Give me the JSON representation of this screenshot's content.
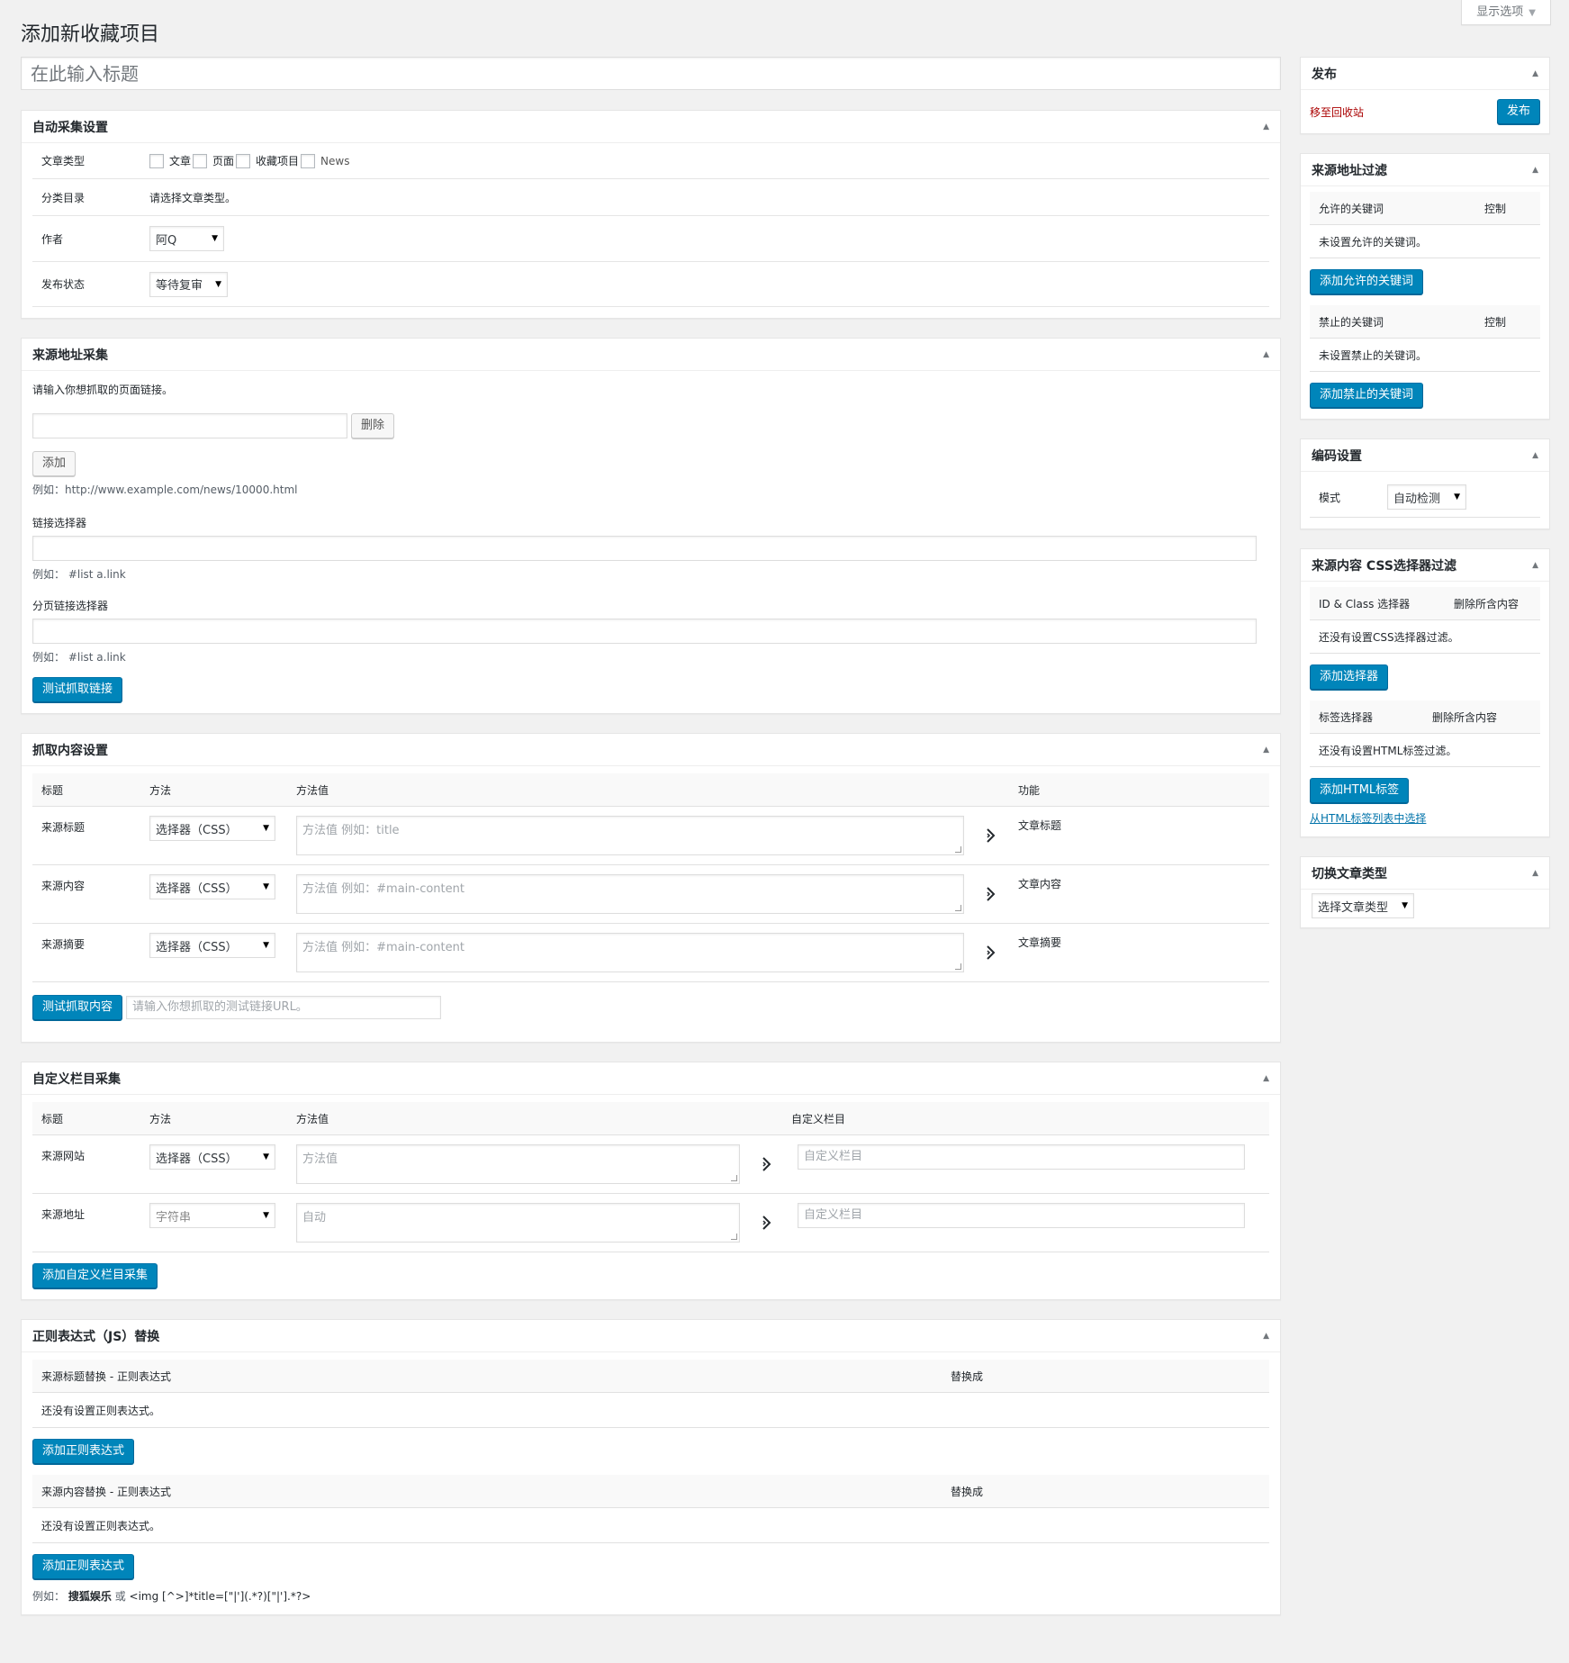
{
  "screen_options": {
    "label": "显示选项"
  },
  "page_title": "添加新收藏项目",
  "title_input": {
    "placeholder": "在此输入标题"
  },
  "auto_collect": {
    "title": "自动采集设置",
    "post_type_label": "文章类型",
    "post_types": [
      "文章",
      "页面",
      "收藏项目",
      "News"
    ],
    "category_label": "分类目录",
    "category_hint": "请选择文章类型。",
    "author_label": "作者",
    "author_value": "阿Q",
    "status_label": "发布状态",
    "status_value": "等待复审"
  },
  "source_url": {
    "title": "来源地址采集",
    "intro": "请输入你想抓取的页面链接。",
    "delete_label": "删除",
    "add_label": "添加",
    "example_url": "例如：http://www.example.com/news/10000.html",
    "link_selector_label": "链接选择器",
    "link_selector_example": "例如：  #list a.link",
    "page_selector_label": "分页链接选择器",
    "page_selector_example": "例如：  #list a.link",
    "test_button": "测试抓取链接"
  },
  "content_settings": {
    "title": "抓取内容设置",
    "headers": [
      "标题",
      "方法",
      "方法值",
      "功能"
    ],
    "rows": [
      {
        "title": "来源标题",
        "method": "选择器（CSS）",
        "placeholder": "方法值 例如：title",
        "function": "文章标题"
      },
      {
        "title": "来源内容",
        "method": "选择器（CSS）",
        "placeholder": "方法值 例如：#main-content",
        "function": "文章内容"
      },
      {
        "title": "来源摘要",
        "method": "选择器（CSS）",
        "placeholder": "方法值 例如：#main-content",
        "function": "文章摘要"
      }
    ],
    "test_button": "测试抓取内容",
    "test_placeholder": "请输入你想抓取的测试链接URL。"
  },
  "custom_fields": {
    "title": "自定义栏目采集",
    "headers": [
      "标题",
      "方法",
      "方法值",
      "自定义栏目"
    ],
    "rows": [
      {
        "title": "来源网站",
        "method": "选择器（CSS）",
        "value": "方法值",
        "field": "自定义栏目"
      },
      {
        "title": "来源地址",
        "method": "字符串",
        "value": "自动",
        "field": "自定义栏目"
      }
    ],
    "add_button": "添加自定义栏目采集"
  },
  "regex": {
    "title": "正则表达式（JS）替换",
    "title_header": "来源标题替换 - 正则表达式",
    "content_header": "来源内容替换 - 正则表达式",
    "replace_header": "替换成",
    "empty_text": "还没有设置正则表达式。",
    "add_button": "添加正则表达式",
    "example_prefix": "例如：",
    "example_bold": "搜狐娱乐",
    "example_or": "或",
    "example_code": "<img [^>]*title=[\"|'](.*?)[\"|'].*?>"
  },
  "publish": {
    "title": "发布",
    "trash_label": "移至回收站",
    "publish_button": "发布"
  },
  "url_filter": {
    "title": "来源地址过滤",
    "allow_header": "允许的关键词",
    "control_header": "控制",
    "allow_empty": "未设置允许的关键词。",
    "allow_button": "添加允许的关键词",
    "deny_header": "禁止的关键词",
    "deny_empty": "未设置禁止的关键词。",
    "deny_button": "添加禁止的关键词"
  },
  "encoding": {
    "title": "编码设置",
    "mode_label": "模式",
    "mode_value": "自动检测"
  },
  "css_filter": {
    "title": "来源内容 CSS选择器过滤",
    "id_header": "ID & Class 选择器",
    "remove_header": "删除所含内容",
    "id_empty": "还没有设置CSS选择器过滤。",
    "id_button": "添加选择器",
    "tag_header": "标签选择器",
    "tag_empty": "还没有设置HTML标签过滤。",
    "tag_button": "添加HTML标签",
    "tag_link": "从HTML标签列表中选择"
  },
  "switch_type": {
    "title": "切换文章类型",
    "select_value": "选择文章类型"
  }
}
